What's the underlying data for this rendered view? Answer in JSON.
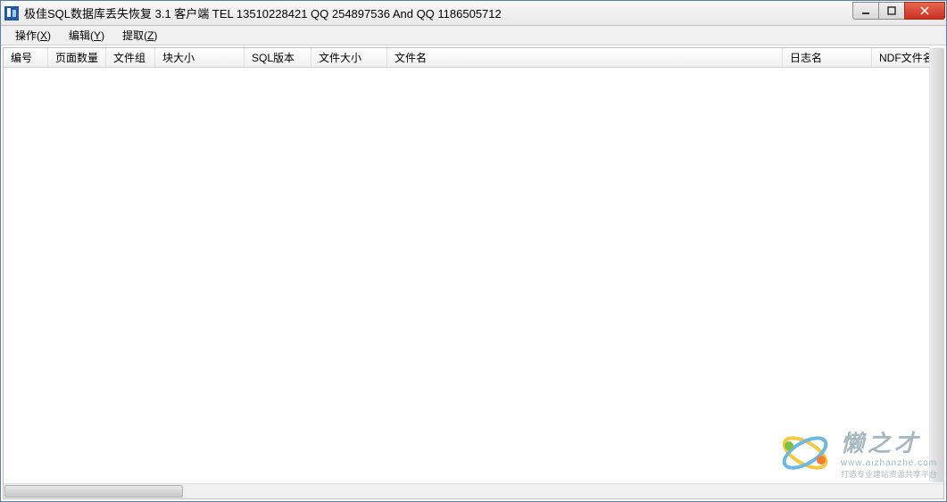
{
  "window": {
    "title": "极佳SQL数据库丢失恢复 3.1 客户端 TEL 13510228421 QQ 254897536 And QQ 1186505712"
  },
  "menubar": {
    "items": [
      {
        "label": "操作",
        "accelerator": "X"
      },
      {
        "label": "编辑",
        "accelerator": "Y"
      },
      {
        "label": "提取",
        "accelerator": "Z"
      }
    ]
  },
  "table": {
    "columns": [
      "编号",
      "页面数量",
      "文件组",
      "块大小",
      "SQL版本",
      "文件大小",
      "文件名",
      "日志名",
      "NDF文件名"
    ],
    "rows": []
  },
  "watermark": {
    "brand": "懒之才",
    "url": "www.aizhanzhe.com",
    "tagline": "打造专业建站资源共享平台"
  }
}
